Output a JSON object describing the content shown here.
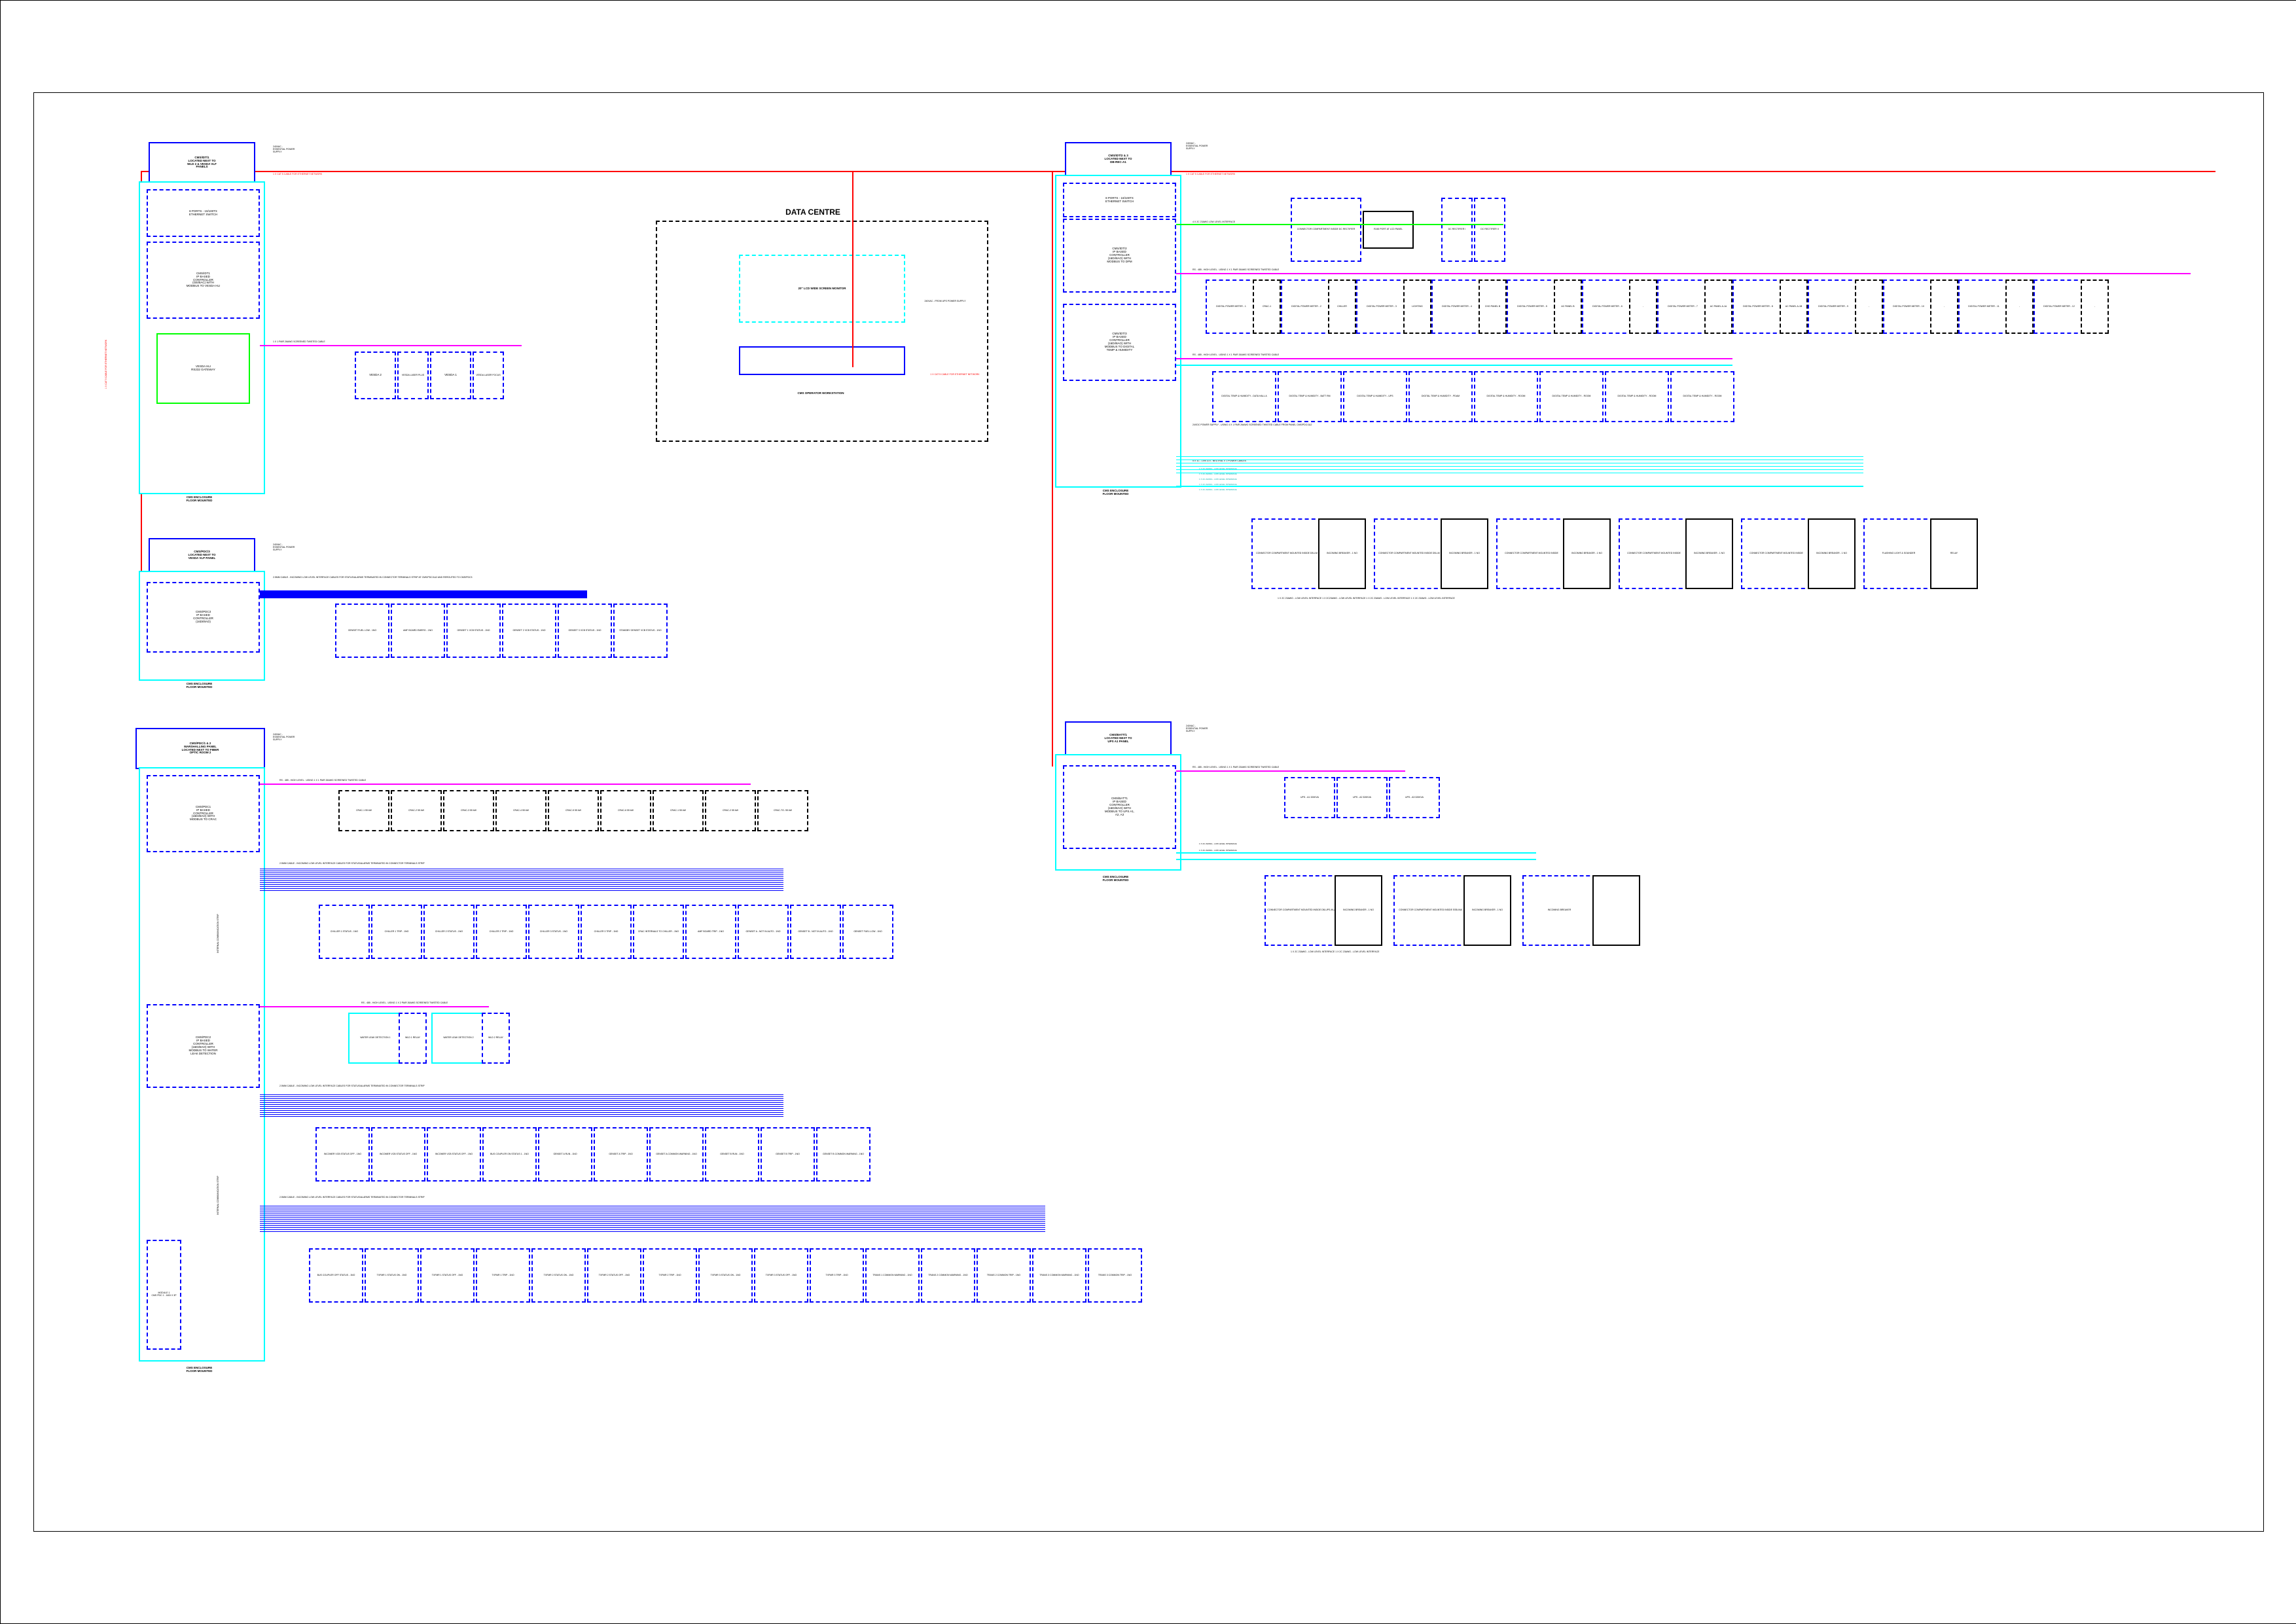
{
  "dataCentre": "DATA CENTRE",
  "monitor": "20\" LCD WIDE SCREEN MONITOR",
  "workstation": "CMS OPERATOR WORKSTATION",
  "wsPower": "240VAC - FROM UPS POWER SUPPLY",
  "wsCable": "1 X CAT 5 CABLE FOR ETHERNET NETWORK",
  "idt1": {
    "title": "CMS/IDT/1\nLOCATED NEXT TO\nWLD 2 & VESDA VLF\nPANELS",
    "switch": "8 PORTS - 10/100TX\nETHERNET SWITCH",
    "ctrl": "CMS/IDT1\nIP BASED\nCONTROLLER\n(GE/BAC) WITH\nMODBUS TO VESDA HLI",
    "vesda": "VESDA HLI\nRS232 GATEWAY",
    "vesdaItems": [
      "VESDA 2",
      "VESDA LASER PLUS",
      "VESDA 1",
      "VESDA LASER FOCUS"
    ],
    "power": "240VAC -\nESSENTIAL POWER\nSUPPLY",
    "cat5": "1 X CAT 5 CABLE FOR ETHERNET NETWORK",
    "tw": "1 X 1 PAIR 26AWG SCREENED TWISTED CABLE",
    "foot": "CMS ENCLOSURE\nFLOOR MOUNTED"
  },
  "pdc3": {
    "title": "CMS/PDC/3\nLOCATED NEXT TO\nVESDA VLP PANEL",
    "ctrl": "CMS/PDC3\nIP BASED\nCONTROLLER\n(16DI/8AO)",
    "power": "240VAC -\nESSENTIAL POWER\nSUPPLY",
    "cable": "2.5MM CABLE - INCOMING LOW LEVEL INTERFACE CABLES FOR STATUS/ALARMS TERMINATED IN CONNECTOR TERMINALS STRIP AT CMS/PDC/1&2 AND REROUTED TO CMS/PDC3",
    "items": [
      "GENSET FUEL LOW - 1NO",
      "AMF BOARD EMERG - 1NO",
      "GENSET 1 VCB STATUS - 1NO",
      "GENSET 2 VCB STATUS - 1NO",
      "GENSET 3 VCB STATUS - 1NO",
      "STANDBY GENSET VCB STATUS - 1NO"
    ],
    "foot": "CMS ENCLOSURE\nFLOOR MOUNTED"
  },
  "pdc12": {
    "title": "CMS/PDC/1 & 2\nMARSHALLING PANEL\nLOCATED NEXT TO FIBER\nOPTIC ROOM 2",
    "power": "240VAC -\nESSENTIAL POWER\nSUPPLY",
    "foot": "CMS ENCLOSURE\nFLOOR MOUNTED"
  },
  "pdc1": {
    "ctrl": "CMS/PDC1\nIP BASED\nCONTROLLER\n(16DI/8AO) WITH\nMODBUS TO CRAC",
    "rs485": "RS - 485 - HIGH LEVEL - USING 1 X 1 PAIR 26AWG SCREENED TWISTED CABLE",
    "cracs": [
      "CRAC-1 55 kW",
      "CRAC-2 55 kW",
      "CRAC-3 55 kW",
      "CRAC-4 55 kW",
      "CRAC-5 55 kW",
      "CRAC-6 55 kW",
      "CRAC-1 55 kW",
      "CRAC-2 55 kW",
      "CRAC-TO- 55 kW"
    ],
    "cable2": "2.5MM CABLE - INCOMING LOW LEVEL INTERFACE CABLES FOR STATUS/ALARMS TERMINATED IN CONNECTOR TERMINALS STRIP",
    "row2": [
      "CHILLER 1 STATUS - 1NO",
      "CHILLER 1 TRIP - 1NO",
      "CHILLER 2 STATUS - 1NO",
      "CHILLER 2 TRIP - 1NO",
      "CHILLER 3 STATUS - 1NO",
      "CHILLER 3 TRIP - 1NO",
      "CRAC INTERNALS TO CHILLER - 1NO",
      "AMF BOARD TRIP - 1NO",
      "GENSET A - NOT IN AUTO - 1NO",
      "GENSET B - NOT IN AUTO - 1NO",
      "GENSET FUEL LOW - 1NO"
    ]
  },
  "pdc2": {
    "ctrl": "CMS/PDC2\nIP BASED\nCONTROLLER\n(16DI/8AO) WITH\nMODBUS TO WATER\nLEAK DETECTION",
    "rs485": "RS - 485 - HIGH LEVEL - USING 1 X 2 PAIR 26AWG SCREENED TWISTED CABLE",
    "wld": [
      "WATER LEAK DETECTION 1",
      "WLD 1 RELAY",
      "WATER LEAK DETECTION 2",
      "WLD 2 RELAY"
    ],
    "cable3": "2.5MM CABLE - INCOMING LOW LEVEL INTERFACE CABLES FOR STATUS/ALARMS TERMINATED IN CONNECTOR TERMINALS STRIP",
    "row3": [
      "INCOMER VCB STATUS OFF - 1NO",
      "INCOMER VCB STATUS OFF - 1NO",
      "INCOMER VCB STATUS OFF - 1NO",
      "BUS COUPLER ON STATUS 1 - 1NO",
      "GENSET A RUN - 1NO",
      "GENSET A TRIP - 1NO",
      "GENSET A COMMON WARNING - 1NO",
      "GENSET B RUN - 1NO",
      "GENSET B TRIP - 1NO",
      "GENSET B COMMON WARNING - 1NO"
    ],
    "cable4": "2.5MM CABLE - INCOMING LOW LEVEL INTERFACE CABLES FOR STATUS/ALARMS TERMINATED IN CONNECTOR TERMINALS STRIP",
    "row4": [
      "BUS COUPLER OFF STATUS - 1NO",
      "TXFMR 1 STATUS ON - 1NO",
      "TXFMR 1 STATUS OFF - 1NO",
      "TXFMR 1 TRIP - 1NO",
      "TXFMR 2 STATUS ON - 1NO",
      "TXFMR 2 STATUS OFF - 1NO",
      "TXFMR 2 TRIP - 1NO",
      "TXFMR 3 STATUS ON - 1NO",
      "TXFMR 3 STATUS OFF - 1NO",
      "TXFMR 3 TRIP - 1NO",
      "TRANS 1 COMMON WARNING - 1NO",
      "TRANS 2 COMMON WARNING - 1NO",
      "TRANS 2 COMMON TRIP - 1NO",
      "TRANS 3 COMMON WARNING - 1NO",
      "TRANS 3 COMMON TRIP - 1NO"
    ],
    "module": "MODULE 1\nCMS PDC 1 - 16DI X 3P"
  },
  "idt23": {
    "title": "CMS/IDT/2 & 3\nLOCATED NEXT TO\nDB-REC-A1",
    "switch": "8 PORTS - 10/100TX\nETHERNET SWITCH",
    "ctrl2": "CMS/IDT/2\nIP BASED\nCONTROLLER\n(16DI/8AO) WITH\nMODBUS TO DPM",
    "ctrl3": "CMS/IDT/3\nIP BASED\nCONTROLLER\n(16DI/8AO) WITH\nMODBUS TO DIGITAL\nTEMP & HUMIDITY",
    "power": "240VAC -\nESSENTIAL POWER\nSUPPLY",
    "cat5": "1 X CAT 5 CABLE FOR ETHERNET NETWORK",
    "lowlvl": "4 X 2C 23AWG LOW LEVEL INTERFACE",
    "rj45": "RJ45 PORT AT LCD PANEL",
    "top": [
      "CONNECTOR COMPARTMENT INSIDE DC RECTIFIER",
      "DC RECTIFIER I",
      "DC RECTIFIER II"
    ],
    "rs485": "RS - 485 - HIGH LEVEL - USING 1 X 1 PAIR 26AWG SCREENED TWISTED CABLE",
    "dpm": [
      "DIGITAL POWER METER - 1",
      "CRAC-1",
      "DIGITAL POWER METER - 2",
      "CHILLER",
      "DIGITAL POWER METER - 3",
      "LIGHTING",
      "DIGITAL POWER METER - 4",
      "CHG PANEL B",
      "DIGITAL POWER METER - 5",
      "AC PANEL B",
      "DIGITAL POWER METER - 6",
      "-",
      "DIGITAL POWER METER - 7",
      "AC PANEL A-1A",
      "DIGITAL POWER METER - 8",
      "AC PANEL A-1B",
      "DIGITAL POWER METER - 9",
      "-",
      "DIGITAL POWER METER - 10",
      "-",
      "DIGITAL POWER METER - 11",
      "-",
      "DIGITAL POWER METER - 12",
      "-"
    ],
    "rs485b": "RS - 485 - HIGH LEVEL - USING 1 X 1 PAIR 26AWG SCREENED TWISTED CABLE",
    "dth": [
      "DIGITAL TEMP & HUMIDITY - DATA HALL A",
      "DIGITAL TEMP & HUMIDITY - BATT RM",
      "DIGITAL TEMP & HUMIDITY - UPS",
      "DIGITAL TEMP & HUMIDITY - PDAM",
      "DIGITAL TEMP & HUMIDITY - ROOM",
      "DIGITAL TEMP & HUMIDITY - ROOM",
      "DIGITAL TEMP & HUMIDITY - ROOM",
      "DIGITAL TEMP & HUMIDITY - ROOM"
    ],
    "powernote": "24VDC POWER SUPPLY - USING 4 X 1 PAIR 26AWG SCREENED TWISTED CABLE FROM PANEL CMS/PDC/1&2",
    "cablesnote": "5 X 1C - LIVE & 5 - NEUTRAL X 1 POWER CABLES",
    "swg": [
      "1 X 2C 23AWG - LOW LEVEL INTERFACE",
      "1 X 2C 23AWG - LOW LEVEL INTERFACE",
      "1 X 2C 23AWG - LOW LEVEL INTERFACE",
      "1 X 2C 23AWG - LOW LEVEL INTERFACE",
      "1 X 2C 23AWG - LOW LEVEL INTERFACE"
    ],
    "rowX": [
      "CONNECTOR COMPARTMENT MOUNTED INSIDE DB-LM",
      "INCOMING BREAKER - 1 NO",
      "CONNECTOR COMPARTMENT MOUNTED INSIDE DB-LM",
      "INCOMING BREAKER - 1 NO",
      "CONNECTOR COMPARTMENT MOUNTED INSIDE",
      "INCOMING BREAKER - 1 NO",
      "CONNECTOR COMPARTMENT MOUNTED INSIDE",
      "INCOMING BREAKER - 1 NO",
      "CONNECTOR COMPARTMENT MOUNTED INSIDE",
      "INCOMING BREAKER - 1 NO",
      "FLASHING LIGHT & SOUNDER",
      "RELAY"
    ],
    "rownote": "1 X 2C 23AWG - LOW LEVEL INTERFACE      1 X 2C23AWG - LOW LEVEL INTERFACE     1 X 2C 23AWG - LOW LEVEL INTERFACE     1 X 2C 23AWG - LOW LEVEL INTERFACE",
    "foot": "CMS ENCLOSURE\nFLOOR MOUNTED"
  },
  "batt": {
    "title": "CMS/BATT/1\nLOCATED NEXT TO\nUPS A1 PANEL",
    "ctrl": "CMS/BATT1\nIP BASED\nCONTROLLER\n(16DI/8AO) WITH\nMODBUS TO UPS A1,\nA2, A3",
    "power": "240VAC -\nESSENTIAL POWER\nSUPPLY",
    "rs485": "RS - 485 - HIGH LEVEL - USING 1 X 1 PAIR 23AWG SCREENED TWISTED CABLE",
    "ups": [
      "UPS - A1 320KVA",
      "UPS - A2 320KVA",
      "UPS - A3 320KVA"
    ],
    "swg": [
      "1 X 2C 23AWG - LOW LEVEL INTERFACE",
      "1 X 2C 23AWG - LOW LEVEL INTERFACE"
    ],
    "row": [
      "CONNECTOR COMPARTMENT MOUNTED INSIDE DB-UPS-IN-A",
      "INCOMING BREAKER - 1 NO",
      "CONNECTOR COMPARTMENT MOUNTED INSIDE SSB-INA",
      "INCOMING BREAKER - 1 NO",
      "INCOMING BREAKER"
    ],
    "rownote": "1 X 2C 23AWG - LOW LEVEL INTERFACE                   1 X 2C 23AWG - LOW LEVEL INTERFACE",
    "foot": "CMS ENCLOSURE\nFLOOR MOUNTED",
    "extnote": "INTERNAL COMMUNICATION STRIP"
  }
}
